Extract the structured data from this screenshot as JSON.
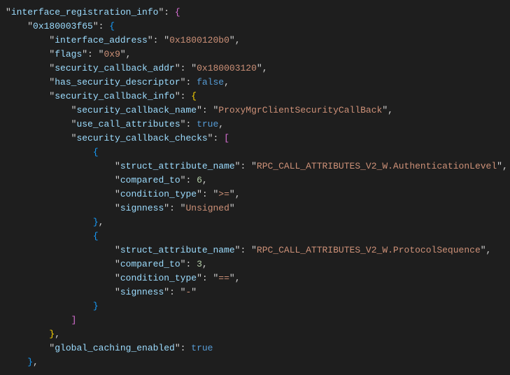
{
  "json_display": {
    "root_key": "interface_registration_info",
    "addr_key": "0x180003f65",
    "interface_address_key": "interface_address",
    "interface_address_val": "0x1800120b0",
    "flags_key": "flags",
    "flags_val": "0x9",
    "security_callback_addr_key": "security_callback_addr",
    "security_callback_addr_val": "0x180003120",
    "has_security_descriptor_key": "has_security_descriptor",
    "has_security_descriptor_val": "false",
    "security_callback_info_key": "security_callback_info",
    "security_callback_name_key": "security_callback_name",
    "security_callback_name_val": "ProxyMgrClientSecurityCallBack",
    "use_call_attributes_key": "use_call_attributes",
    "use_call_attributes_val": "true",
    "security_callback_checks_key": "security_callback_checks",
    "checks": [
      {
        "struct_attribute_name_key": "struct_attribute_name",
        "struct_attribute_name_val": "RPC_CALL_ATTRIBUTES_V2_W.AuthenticationLevel",
        "compared_to_key": "compared_to",
        "compared_to_val": "6",
        "condition_type_key": "condition_type",
        "condition_type_val": ">=",
        "signness_key": "signness",
        "signness_val": "Unsigned"
      },
      {
        "struct_attribute_name_key": "struct_attribute_name",
        "struct_attribute_name_val": "RPC_CALL_ATTRIBUTES_V2_W.ProtocolSequence",
        "compared_to_key": "compared_to",
        "compared_to_val": "3",
        "condition_type_key": "condition_type",
        "condition_type_val": "==",
        "signness_key": "signness",
        "signness_val": "-"
      }
    ],
    "global_caching_enabled_key": "global_caching_enabled",
    "global_caching_enabled_val": "true"
  }
}
